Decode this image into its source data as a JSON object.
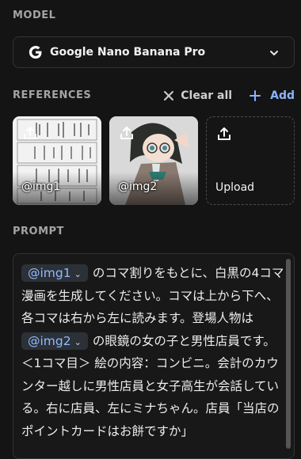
{
  "model": {
    "section_label": "MODEL",
    "selected": "Google Nano Banana Pro",
    "icon": "google-g-icon"
  },
  "references": {
    "section_label": "REFERENCES",
    "clear_all_label": "Clear all",
    "add_label": "Add",
    "tiles": [
      {
        "caption": "@img1",
        "kind": "manga-page"
      },
      {
        "caption": "@img2",
        "kind": "character-illustration"
      },
      {
        "caption": "Upload",
        "kind": "upload"
      }
    ]
  },
  "prompt": {
    "section_label": "PROMPT",
    "chip1": "@img1",
    "part1": "のコマ割りをもとに、白黒の4コマ漫画を生成してください。コマは上から下へ、各コマは右から左に読みます。登場人物は",
    "chip2": "@img2",
    "part2": "の眼鏡の女の子と男性店員です。＜1コマ目＞ 絵の内容：コンビニ。会計のカウンター越しに男性店員と女子高生が会話している。右に店員、左にミナちゃん。店員「当店のポイントカードはお餅ですか」"
  },
  "colors": {
    "background": "#141414",
    "accent": "#8ab4ff",
    "label": "#a4a4a4"
  }
}
